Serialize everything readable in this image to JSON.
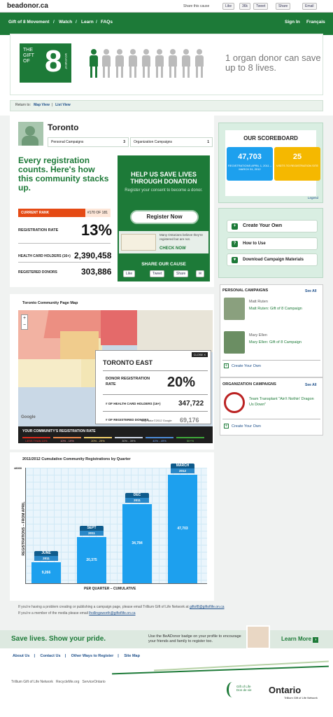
{
  "header": {
    "logo": "beadonor.ca",
    "share_label": "Share this cause",
    "share_buttons": [
      "Like",
      "36k",
      "Tweet",
      "Share",
      "Email"
    ]
  },
  "nav": {
    "items": [
      "Gift of 8 Movement",
      "Watch",
      "Learn",
      "FAQs"
    ],
    "signin": "Sign In",
    "lang": "Français"
  },
  "banner": {
    "gift_top": "THE\nGIFT\nOF",
    "gift_num": "8",
    "movement": "MOVEMENT",
    "tagline": "1 organ donor can save up to 8 lives."
  },
  "breadcrumb": {
    "return": "Return to:",
    "map_view": "Map View",
    "list_view": "List View"
  },
  "community": {
    "city": "Toronto",
    "tab_personal": "Personal Campaigns",
    "tab_personal_count": "3",
    "tab_org": "Organization Campaigns",
    "tab_org_count": "1",
    "headline": "Every registration counts. Here's how this community stacks up.",
    "rank_label": "CURRENT RANK",
    "rank_value": "#170 OF 181",
    "reg_rate_label": "REGISTRATION RATE",
    "reg_rate": "13%",
    "holders_label": "HEALTH CARD HOLDERS (16+)",
    "holders": "2,390,458",
    "donors_label": "REGISTERED DONORS",
    "donors": "303,886"
  },
  "help": {
    "title": "HELP US SAVE LIVES THROUGH DONATION",
    "sub": "Register your consent to become a donor.",
    "register_btn": "Register Now",
    "info": "Many Ontarians believe they're registered but are not.",
    "check_now": "CHECK NOW",
    "share_title": "SHARE OUR CAUSE",
    "share_btns": [
      "Like",
      "Tweet",
      "Share"
    ]
  },
  "scoreboard": {
    "title": "OUR SCOREBOARD",
    "reg_num": "47,703",
    "reg_cap": "REGISTRATIONS APRIL 1, 2011 – MARCH 31, 2012",
    "visits_num": "25",
    "visits_cap": "VISITS TO REGISTRATION SITE",
    "legend": "Legend"
  },
  "actions": {
    "create": "Create Your Own",
    "howto": "How to Use",
    "download": "Download Campaign Materials"
  },
  "sidebar": {
    "personal_title": "PERSONAL CAMPAIGNS",
    "see_all": "See All",
    "c1_name": "Matt Ruten",
    "c1_link": "Matt Ruten: Gift of 8 Campaign",
    "c2_name": "Mary Ellen",
    "c2_link": "Mary Ellen: Gift of 8 Campaign",
    "create": "Create Your Own",
    "org_title": "ORGANIZATION CAMPAIGNS",
    "org_link": "Team Transplant \"Ain't Nothin' Dragon Us Down\""
  },
  "map": {
    "title": "Toronto Community Page Map",
    "close": "CLOSE X",
    "popup_title": "TORONTO EAST",
    "popup_rate_label": "DONOR REGISTRATION RATE",
    "popup_rate": "20%",
    "popup_holders_label": "# OF HEALTH CARD HOLDERS (16+)",
    "popup_holders": "347,722",
    "popup_donors_label": "# OF REGISTERED DONORS",
    "popup_donors": "69,176",
    "google": "Google",
    "mapdata": "Map data ©2012 Google",
    "legend_title": "YOUR COMMUNITY'S REGISTRATION RATE",
    "legend": [
      "LESS THAN 10%",
      "10% - 19%",
      "20% - 29%",
      "30% - 39%",
      "40% - 49%",
      "50+%"
    ]
  },
  "chart_data": {
    "type": "bar",
    "title": "2011/2012 Cumulative Community Registrations by Quarter",
    "xlabel": "PER QUARTER – CUMULATIVE",
    "ylabel": "REGISTRATIONS – FROM APRIL",
    "ylim": [
      0,
      48000
    ],
    "ymax_label": "48000",
    "categories": [
      {
        "month": "JUNE",
        "year": "2011"
      },
      {
        "month": "SEPT",
        "year": "2011"
      },
      {
        "month": "DEC",
        "year": "2011"
      },
      {
        "month": "MARCH",
        "year": "2012"
      }
    ],
    "values": [
      9266,
      20375,
      34784,
      47703
    ],
    "value_labels": [
      "9,266",
      "20,375",
      "34,784",
      "47,703"
    ]
  },
  "notes": {
    "line1a": "If you're having a problem creating or publishing a campaign page, please email Trillium Gift of Life Network at ",
    "line1b": "giftof8@giftoflife.on.ca",
    "line2a": "If you're a member of the media please email ",
    "line2b": "lhollingsworth@giftoflife.on.ca"
  },
  "promo": {
    "title": "Save lives. Show your pride.",
    "text": "Use the BeADonor badge on your profile to encourage your friends and family to register too.",
    "learn": "Learn More"
  },
  "footer": {
    "links": [
      "About Us",
      "Contact Us",
      "Other Ways to Register",
      "Site Map"
    ],
    "partners": [
      "Trillium Gift of Life Network",
      "RecycleMe.org",
      "ServiceOntario"
    ],
    "gol": "Gift of Life\nDon de vie",
    "ontario": "Ontario",
    "tgln": "Trillium Gift of Life Network"
  },
  "colors": {
    "brand": "#1d7a38",
    "blue": "#1da0ee",
    "orange": "#e54a14",
    "yellow": "#f5b800"
  }
}
